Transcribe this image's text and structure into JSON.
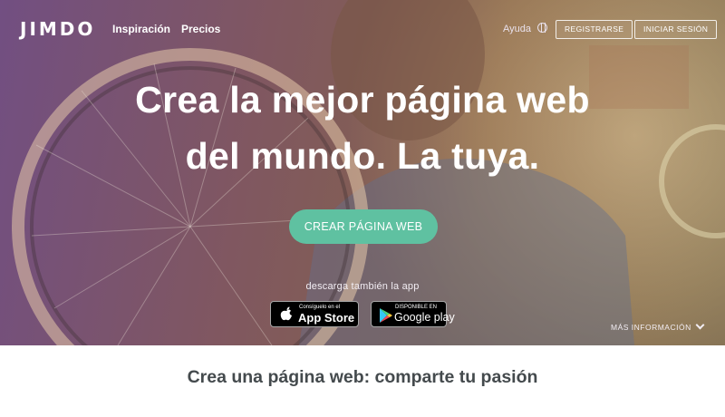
{
  "brand": {
    "logo_text": "JIMDO"
  },
  "nav": {
    "links": [
      "Inspiración",
      "Precios"
    ],
    "help_label": "Ayuda",
    "register_label": "REGISTRARSE",
    "login_label": "INICIAR SESIÓN"
  },
  "hero": {
    "headline_line1": "Crea la mejor página web",
    "headline_line2": "del mundo. La tuya.",
    "cta_label": "CREAR PÁGINA WEB",
    "app_note": "descarga también la app",
    "more_info_label": "MÁS INFORMACIÓN"
  },
  "app_store": {
    "small_text": "Consíguelo en el",
    "big_text": "App Store"
  },
  "google_play": {
    "small_text": "DISPONIBLE EN",
    "big_text": "Google play"
  },
  "section": {
    "title": "Crea una página web: comparte tu pasión"
  },
  "colors": {
    "accent": "#5fc1a1",
    "overlay": "#7a5496",
    "text_dark": "#444a4d"
  }
}
